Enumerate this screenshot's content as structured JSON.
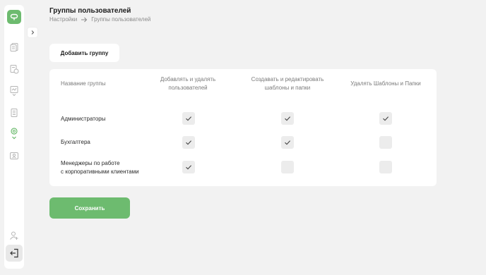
{
  "header": {
    "title": "Группы пользователей",
    "breadcrumb": [
      "Настройки",
      "Группы пользователей"
    ]
  },
  "toolbar": {
    "add_group_label": "Добавить группу"
  },
  "table": {
    "headers": {
      "name": "Название группы",
      "col1_line1": "Добавлять и удалять",
      "col1_line2": "пользователей",
      "col2_line1": "Создавать и редактировать",
      "col2_line2": "шаблоны и папки",
      "col3": "Удалять Шаблоны и Папки"
    },
    "rows": [
      {
        "name_line1": "Администраторы",
        "name_line2": "",
        "perms": [
          true,
          true,
          true
        ]
      },
      {
        "name_line1": "Бухгалтера",
        "name_line2": "",
        "perms": [
          true,
          true,
          false
        ]
      },
      {
        "name_line1": "Менеджеры по работе",
        "name_line2": "с корпоративными клиентами",
        "perms": [
          true,
          false,
          false
        ]
      }
    ]
  },
  "footer": {
    "save_label": "Сохранить"
  },
  "sidebar": {
    "icons": [
      "logo-icon",
      "documents-icon",
      "templates-icon",
      "signature-icon",
      "archive-icon",
      "settings-icon",
      "id-card-icon",
      "add-user-icon",
      "exit-icon"
    ]
  },
  "colors": {
    "accent": "#6dbb6f",
    "background": "#f2f2f2",
    "checkbox": "#ececec"
  }
}
